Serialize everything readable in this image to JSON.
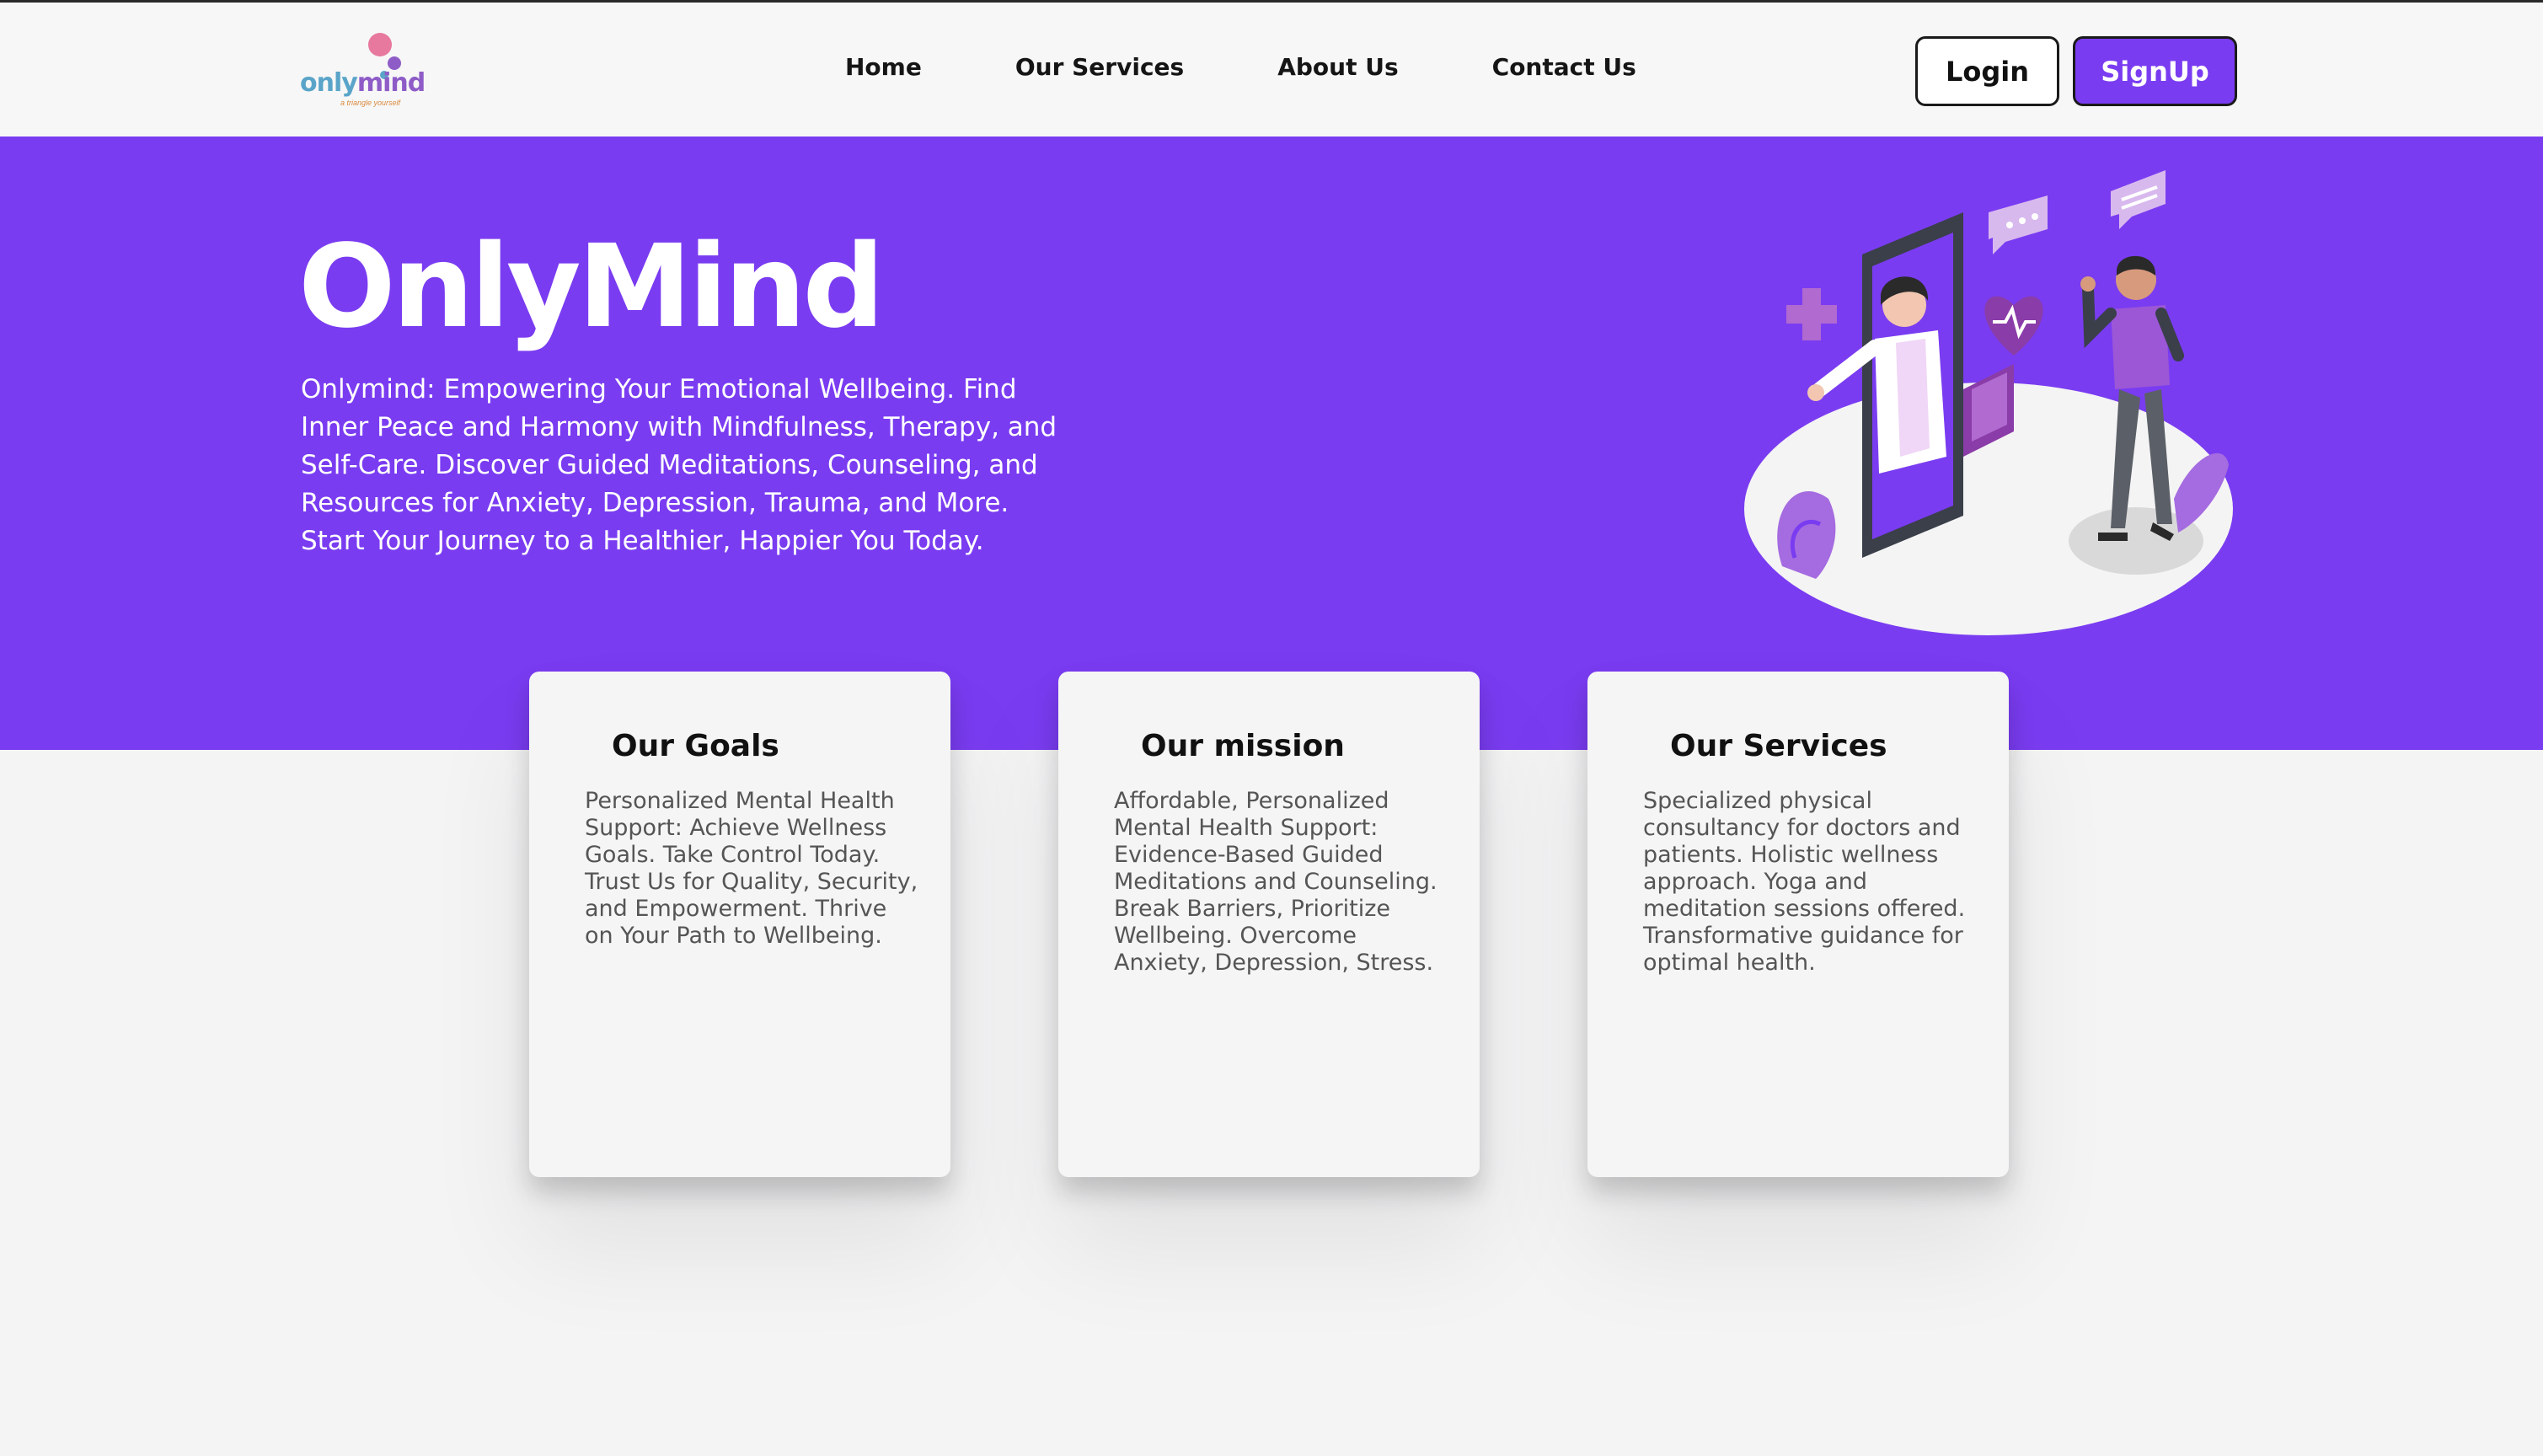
{
  "nav": {
    "logo": {
      "brand_part1": "only",
      "brand_part2": "mind",
      "tagline": "a triangle yourself"
    },
    "links": [
      "Home",
      "Our Services",
      "About Us",
      "Contact Us"
    ],
    "login_label": "Login",
    "signup_label": "SignUp"
  },
  "hero": {
    "title": "OnlyMind",
    "description": "Onlymind: Empowering Your Emotional Wellbeing. Find Inner Peace and Harmony with Mindfulness, Therapy, and Self-Care. Discover Guided Meditations, Counseling, and Resources for Anxiety, Depression, Trauma, and More. Start Your Journey to a Healthier, Happier You Today."
  },
  "cards": [
    {
      "title": "Our Goals",
      "text": "Personalized Mental Health Support: Achieve Wellness Goals. Take Control Today. Trust Us for Quality, Security, and Empowerment. Thrive on Your Path to Wellbeing."
    },
    {
      "title": "Our mission",
      "text": "Affordable, Personalized Mental Health Support: Evidence-Based Guided Meditations and Counseling. Break Barriers, Prioritize Wellbeing. Overcome Anxiety, Depression, Stress."
    },
    {
      "title": "Our Services",
      "text": "Specialized physical consultancy for doctors and patients. Holistic wellness approach. Yoga and meditation sessions offered. Transformative guidance for optimal health."
    }
  ],
  "colors": {
    "accent": "#7a3cf1",
    "background": "#f4f4f5",
    "card": "#f6f5f6"
  }
}
